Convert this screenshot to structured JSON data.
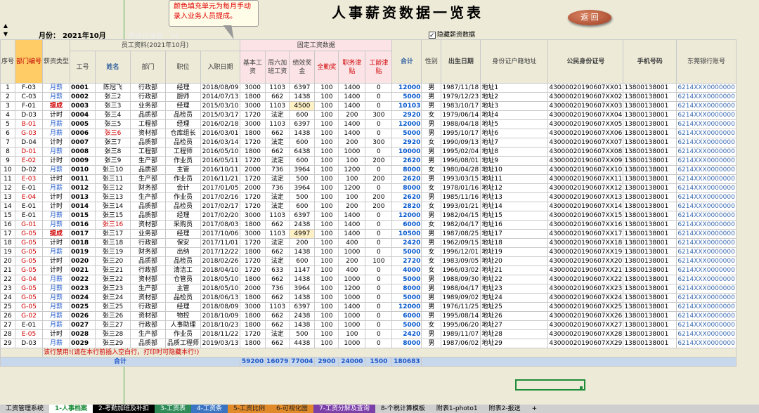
{
  "title": "人事薪资数据一览表",
  "callout": "颜色填充单元为每月手动录入业务人员提成。",
  "back_button": "返 回",
  "month_label": "月份：",
  "month_value": "2021年10月",
  "filter_count_label": "筛选记录数：29",
  "checkbox_label": "隐藏薪资数据",
  "header": {
    "group_emp": "员工资料(2021年10月)",
    "group_fixed": "固定工资数据",
    "cols": [
      "序号",
      "部门编号",
      "薪资类型",
      "工号",
      "姓名",
      "部门",
      "职位",
      "入职日期",
      "基本工资",
      "周六加班工资",
      "绩效奖金",
      "全勤奖",
      "职务津贴",
      "工龄津贴",
      "合计",
      "性别",
      "出生日期",
      "身份证户籍地址",
      "公民身份证号",
      "手机号码",
      "东莞银行账号"
    ]
  },
  "rows": [
    [
      "1",
      "F-03",
      "月薪",
      "0001",
      "陈冠飞",
      "行政部",
      "经理",
      "2018/08/09",
      "3000",
      "1103",
      "6397",
      "100",
      "1400",
      "0",
      "12000",
      "男",
      "1987/11/18",
      "地址1",
      "43000020190607XX01",
      "13800138001",
      "6214XXX0000000"
    ],
    [
      "2",
      "C-03",
      "月薪",
      "0002",
      "张三2",
      "行政部",
      "厨师",
      "2014/07/13",
      "1800",
      "662",
      "1438",
      "100",
      "1400",
      "0",
      "5000",
      "男",
      "1979/12/23",
      "地址2",
      "43000020190607XX02",
      "13800138001",
      "6214XXX0000000"
    ],
    [
      "3",
      "F-01",
      "提成",
      "0003",
      "张三3",
      "业务部",
      "经理",
      "2015/03/10",
      "3000",
      "1103",
      "4500",
      "100",
      "1400",
      "0",
      "10103",
      "男",
      "1983/10/17",
      "地址3",
      "43000020190607XX03",
      "13800138001",
      "6214XXX0000000"
    ],
    [
      "4",
      "D-03",
      "计时",
      "0004",
      "张三4",
      "品质部",
      "品检员",
      "2015/03/17",
      "1720",
      "法定",
      "600",
      "100",
      "200",
      "300",
      "2920",
      "女",
      "1979/06/14",
      "地址4",
      "43000020190607XX04",
      "13800138001",
      "6214XXX0000000"
    ],
    [
      "5",
      "B-01",
      "月薪",
      "0005",
      "张三5",
      "工程部",
      "经理",
      "2016/02/18",
      "3000",
      "1103",
      "6397",
      "100",
      "1400",
      "0",
      "12000",
      "男",
      "1988/04/18",
      "地址5",
      "43000020190607XX05",
      "13800138001",
      "6214XXX0000000"
    ],
    [
      "6",
      "G-03",
      "月薪",
      "0006",
      "张三6",
      "资材部",
      "仓库组长",
      "2016/03/01",
      "1800",
      "662",
      "1438",
      "100",
      "1400",
      "0",
      "5000",
      "男",
      "1995/10/17",
      "地址6",
      "43000020190607XX06",
      "13800138001",
      "6214XXX0000000"
    ],
    [
      "7",
      "D-04",
      "计时",
      "0007",
      "张三7",
      "品质部",
      "品检员",
      "2016/03/14",
      "1720",
      "法定",
      "600",
      "100",
      "200",
      "300",
      "2920",
      "女",
      "1990/09/13",
      "地址7",
      "43000020190607XX07",
      "13800138001",
      "6214XXX0000000"
    ],
    [
      "8",
      "D-01",
      "月薪",
      "0008",
      "张三8",
      "工程部",
      "工程师",
      "2016/05/10",
      "1800",
      "662",
      "6438",
      "100",
      "1000",
      "0",
      "10000",
      "男",
      "1995/02/04",
      "地址8",
      "43000020190607XX08",
      "13800138001",
      "6214XXX0000000"
    ],
    [
      "9",
      "E-02",
      "计时",
      "0009",
      "张三9",
      "生产部",
      "作业员",
      "2016/05/11",
      "1720",
      "法定",
      "600",
      "100",
      "100",
      "200",
      "2620",
      "男",
      "1996/08/01",
      "地址9",
      "43000020190607XX09",
      "13800138001",
      "6214XXX0000000"
    ],
    [
      "10",
      "D-02",
      "月薪",
      "0010",
      "张三10",
      "品质部",
      "主管",
      "2016/10/11",
      "2000",
      "736",
      "3964",
      "100",
      "1200",
      "0",
      "8000",
      "女",
      "1980/04/28",
      "地址10",
      "43000020190607XX10",
      "13800138001",
      "6214XXX0000000"
    ],
    [
      "11",
      "E-03",
      "计时",
      "0011",
      "张三11",
      "生产部",
      "作业员",
      "2016/11/21",
      "1720",
      "法定",
      "500",
      "100",
      "100",
      "200",
      "2620",
      "男",
      "1993/03/15",
      "地址11",
      "43000020190607XX11",
      "13800138001",
      "6214XXX0000000"
    ],
    [
      "12",
      "E-01",
      "月薪",
      "0012",
      "张三12",
      "财务部",
      "会计",
      "2017/01/05",
      "2000",
      "736",
      "3964",
      "100",
      "1200",
      "0",
      "8000",
      "女",
      "1978/01/16",
      "地址12",
      "43000020190607XX12",
      "13800138001",
      "6214XXX0000000"
    ],
    [
      "13",
      "E-04",
      "计时",
      "0013",
      "张三13",
      "生产部",
      "作业员",
      "2017/02/16",
      "1720",
      "法定",
      "500",
      "100",
      "100",
      "200",
      "2620",
      "男",
      "1985/11/16",
      "地址13",
      "43000020190607XX13",
      "13800138001",
      "6214XXX0000000"
    ],
    [
      "14",
      "E-01",
      "计时",
      "0014",
      "张三14",
      "品质部",
      "品检员",
      "2017/02/17",
      "1720",
      "法定",
      "600",
      "100",
      "200",
      "200",
      "2820",
      "女",
      "1993/01/21",
      "地址14",
      "43000020190607XX14",
      "13800138001",
      "6214XXX0000000"
    ],
    [
      "15",
      "E-01",
      "月薪",
      "0015",
      "张三15",
      "品质部",
      "经理",
      "2017/02/20",
      "3000",
      "1103",
      "6397",
      "100",
      "1400",
      "0",
      "12000",
      "男",
      "1982/04/15",
      "地址15",
      "43000020190607XX15",
      "13800138001",
      "6214XXX0000000"
    ],
    [
      "16",
      "G-01",
      "月薪",
      "0016",
      "张三16",
      "资材部",
      "采购员",
      "2017/08/03",
      "1800",
      "662",
      "2438",
      "100",
      "1400",
      "0",
      "6000",
      "女",
      "1982/04/17",
      "地址16",
      "43000020190607XX16",
      "13800138001",
      "6214XXX0000000"
    ],
    [
      "17",
      "G-05",
      "提成",
      "0017",
      "张三17",
      "业务部",
      "经理",
      "2017/10/06",
      "3000",
      "1103",
      "4997",
      "100",
      "1400",
      "0",
      "10500",
      "男",
      "1987/08/25",
      "地址17",
      "43000020190607XX17",
      "13800138001",
      "6214XXX0000000"
    ],
    [
      "18",
      "G-05",
      "计时",
      "0018",
      "张三18",
      "行政部",
      "保安",
      "2017/11/01",
      "1720",
      "法定",
      "200",
      "100",
      "400",
      "0",
      "2420",
      "男",
      "1962/09/15",
      "地址18",
      "43000020190607XX18",
      "13800138001",
      "6214XXX0000000"
    ],
    [
      "19",
      "G-05",
      "月薪",
      "0019",
      "张三19",
      "财务部",
      "出纳",
      "2017/12/22",
      "1800",
      "662",
      "1438",
      "100",
      "1000",
      "0",
      "5000",
      "女",
      "1996/12/01",
      "地址19",
      "43000020190607XX19",
      "13800138001",
      "6214XXX0000000"
    ],
    [
      "20",
      "G-05",
      "计时",
      "0020",
      "张三20",
      "品质部",
      "品检员",
      "2018/02/26",
      "1720",
      "法定",
      "600",
      "100",
      "200",
      "100",
      "2720",
      "女",
      "1983/09/05",
      "地址20",
      "43000020190607XX20",
      "13800138001",
      "6214XXX0000000"
    ],
    [
      "21",
      "G-05",
      "计时",
      "0021",
      "张三21",
      "行政部",
      "清洁工",
      "2018/04/10",
      "1720",
      "633",
      "1147",
      "100",
      "400",
      "0",
      "4000",
      "女",
      "1966/03/02",
      "地址21",
      "43000020190607XX21",
      "13800138001",
      "6214XXX0000000"
    ],
    [
      "22",
      "G-04",
      "月薪",
      "0022",
      "张三22",
      "资材部",
      "仓管员",
      "2018/05/10",
      "1800",
      "662",
      "1438",
      "100",
      "1000",
      "0",
      "5000",
      "男",
      "1988/09/30",
      "地址22",
      "43000020190607XX22",
      "13800138001",
      "6214XXX0000000"
    ],
    [
      "23",
      "G-05",
      "月薪",
      "0023",
      "张三23",
      "生产部",
      "主管",
      "2018/05/10",
      "2000",
      "736",
      "3964",
      "100",
      "1200",
      "0",
      "8000",
      "男",
      "1988/04/17",
      "地址23",
      "43000020190607XX23",
      "13800138001",
      "6214XXX0000000"
    ],
    [
      "24",
      "G-05",
      "月薪",
      "0024",
      "张三24",
      "资材部",
      "品检员",
      "2018/06/13",
      "1800",
      "662",
      "1438",
      "100",
      "1000",
      "0",
      "5000",
      "男",
      "1989/09/02",
      "地址24",
      "43000020190607XX24",
      "13800138001",
      "6214XXX0000000"
    ],
    [
      "25",
      "G-05",
      "月薪",
      "0025",
      "张三25",
      "行政部",
      "经理",
      "2018/08/09",
      "3000",
      "1103",
      "6397",
      "100",
      "1400",
      "0",
      "12000",
      "男",
      "1976/11/25",
      "地址25",
      "43000020190607XX25",
      "13800138001",
      "6214XXX0000000"
    ],
    [
      "26",
      "G-02",
      "月薪",
      "0026",
      "张三26",
      "资材部",
      "物控",
      "2018/10/09",
      "1800",
      "662",
      "2438",
      "100",
      "1000",
      "0",
      "6000",
      "男",
      "1995/08/14",
      "地址26",
      "43000020190607XX26",
      "13800138001",
      "6214XXX0000000"
    ],
    [
      "27",
      "E-01",
      "月薪",
      "0027",
      "张三27",
      "行政部",
      "人事助理",
      "2018/10/23",
      "1800",
      "662",
      "1438",
      "100",
      "1000",
      "0",
      "5000",
      "女",
      "1995/06/20",
      "地址27",
      "43000020190607XX27",
      "13800138001",
      "6214XXX0000000"
    ],
    [
      "28",
      "E-05",
      "计时",
      "0028",
      "张三28",
      "生产部",
      "作业员",
      "2018/11/22",
      "1720",
      "法定",
      "500",
      "100",
      "100",
      "0",
      "2420",
      "男",
      "1989/11/07",
      "地址28",
      "43000020190607XX28",
      "13800138001",
      "6214XXX0000000"
    ],
    [
      "29",
      "D-03",
      "月薪",
      "0029",
      "张三29",
      "品质部",
      "品质工程师",
      "2019/03/13",
      "1800",
      "662",
      "4438",
      "100",
      "1000",
      "0",
      "8000",
      "男",
      "1987/06/02",
      "地址29",
      "43000020190607XX29",
      "13800138001",
      "6214XXX0000000"
    ]
  ],
  "note_row": "该行禁用!(请在本行前插入空白行，打印时可隐藏本行!)",
  "total_label": "合计",
  "totals": [
    "59200",
    "16079",
    "77004",
    "2900",
    "24000",
    "1500",
    "180683"
  ],
  "tabs": [
    "工资管理系统",
    "1-人事档案",
    "2-考勤加班及补扣",
    "3-工资表",
    "4-工资条",
    "5-工资比例",
    "6-可视化图",
    "7-工资分解及查询",
    "8-个税计算模板",
    "附表1-photo1",
    "附表2-报送",
    "+"
  ],
  "tab_colors": [
    "#CFCFCF",
    "#FFFFFF",
    "#000000",
    "#2E8B57",
    "#3A74C2",
    "#E08A2A",
    "#E08A2A",
    "#7B3FA8",
    "#CFCFCF",
    "#CFCFCF",
    "#CFCFCF",
    "#CFCFCF"
  ],
  "colors": {
    "accent_red": "#D00000",
    "accent_blue": "#1F58C8",
    "header_bg": "#EDEAD7"
  }
}
